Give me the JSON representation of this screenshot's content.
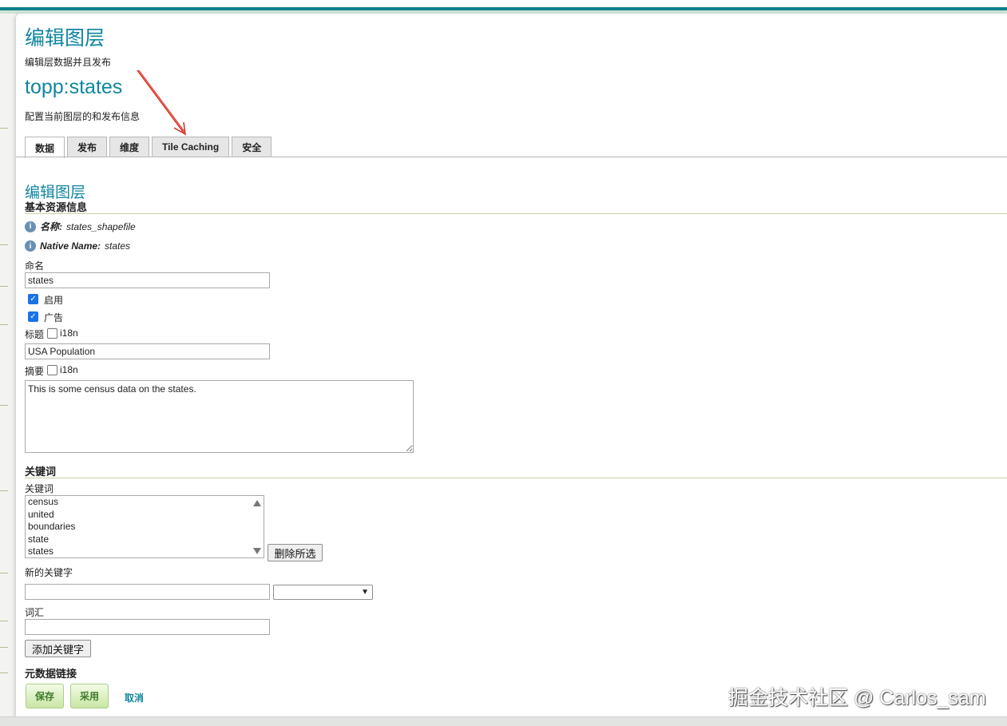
{
  "header": {
    "page_title": "编辑图层",
    "page_subtitle": "编辑层数据并且发布",
    "layer_name": "topp:states",
    "layer_desc": "配置当前图层的和发布信息"
  },
  "tabs": [
    {
      "label": "数据",
      "active": true
    },
    {
      "label": "发布",
      "active": false
    },
    {
      "label": "维度",
      "active": false
    },
    {
      "label": "Tile Caching",
      "active": false
    },
    {
      "label": "安全",
      "active": false
    }
  ],
  "section": {
    "title": "编辑图层",
    "basic_info_title": "基本资源信息",
    "name_info_label": "名称:",
    "name_info_value": "states_shapefile",
    "native_name_label": "Native Name:",
    "native_name_value": "states"
  },
  "form": {
    "name_label": "命名",
    "name_value": "states",
    "enabled_label": "启用",
    "enabled_checked": true,
    "advertised_label": "广告",
    "advertised_checked": true,
    "title_label": "标题",
    "title_i18n": "i18n",
    "title_value": "USA Population",
    "abstract_label": "摘要",
    "abstract_i18n": "i18n",
    "abstract_value": "This is some census data on the states."
  },
  "keywords": {
    "section_title": "关键词",
    "list_label": "关键词",
    "items": [
      "census",
      "united",
      "boundaries",
      "state",
      "states"
    ],
    "remove_button": "删除所选",
    "new_keyword_label": "新的关键字",
    "new_keyword_value": "",
    "vocabulary_label": "词汇",
    "vocabulary_value": "",
    "add_button": "添加关键字"
  },
  "metadata": {
    "section_title": "元数据链接"
  },
  "actions": {
    "save": "保存",
    "apply": "采用",
    "cancel": "取消"
  },
  "watermark": "掘金技术社区 @ Carlos_sam",
  "colors": {
    "accent": "#0f86a0",
    "annotation_arrow": "#d9281c",
    "button_green": "#3e7a2a"
  }
}
